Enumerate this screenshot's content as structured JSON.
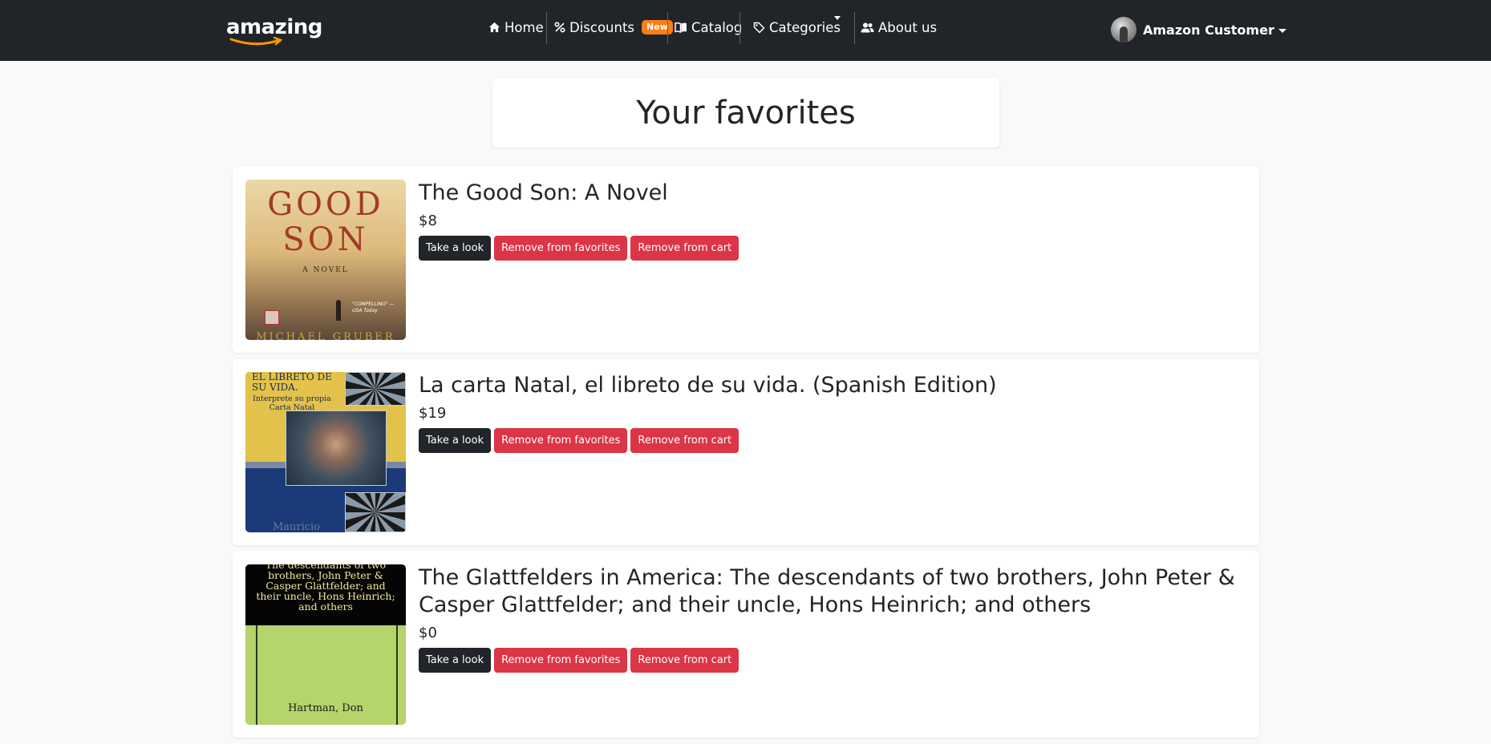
{
  "brand": {
    "name": "amazing"
  },
  "nav": {
    "home": "Home",
    "discounts": "Discounts",
    "discounts_badge": "New",
    "catalog": "Catalog",
    "categories": "Categories",
    "about": "About us"
  },
  "user": {
    "name": "Amazon Customer"
  },
  "page": {
    "title": "Your favorites"
  },
  "products": [
    {
      "title": "The Good Son: A Novel",
      "price": "$8",
      "cover": {
        "line1": "GOOD",
        "line2": "SON",
        "subtitle": "A NOVEL",
        "quote": "\"COMPELLING\" —USA Today",
        "author": "MICHAEL GRUBER"
      }
    },
    {
      "title": "La carta Natal, el libreto de su vida. (Spanish Edition)",
      "price": "$19",
      "cover": {
        "line1": "EL LIBRETO DE SU VIDA.",
        "line2": "Interprete su propia Carta Natal",
        "author": "Mauricio"
      }
    },
    {
      "title": "The Glattfelders in America: The descendants of two brothers, John Peter & Casper Glattfelder; and their uncle, Hons Heinrich; and others",
      "price": "$0",
      "cover": {
        "line1": "The descendants of two brothers, John Peter & Casper Glattfelder; and their uncle, Hons Heinrich; and others",
        "author": "Hartman, Don"
      }
    }
  ],
  "buttons": {
    "take_look": "Take a look",
    "remove_favorites": "Remove from favorites",
    "remove_cart": "Remove from cart"
  },
  "colors": {
    "navbar": "#212529",
    "badge": "#fd7e14",
    "danger": "#dc3545",
    "dark": "#212529",
    "background": "#f8f9fa"
  }
}
